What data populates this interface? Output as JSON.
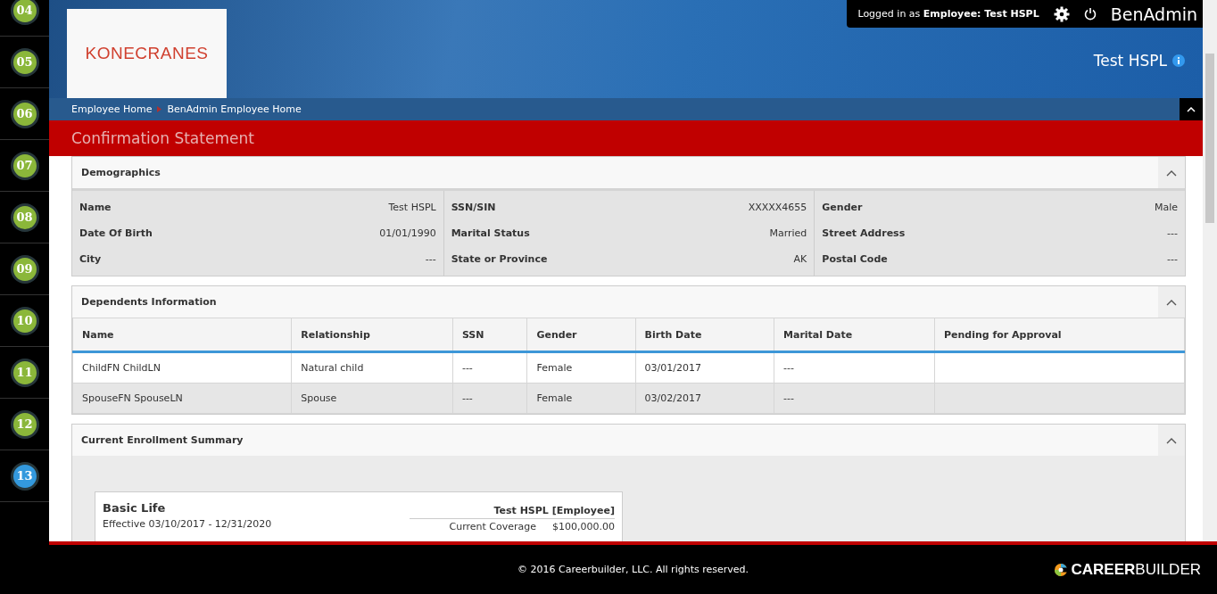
{
  "sidebar": {
    "steps": [
      {
        "label": "04",
        "selected": false
      },
      {
        "label": "05",
        "selected": false
      },
      {
        "label": "06",
        "selected": false
      },
      {
        "label": "07",
        "selected": false
      },
      {
        "label": "08",
        "selected": false
      },
      {
        "label": "09",
        "selected": false
      },
      {
        "label": "10",
        "selected": false
      },
      {
        "label": "11",
        "selected": false
      },
      {
        "label": "12",
        "selected": false
      },
      {
        "label": "13",
        "selected": true
      }
    ]
  },
  "header": {
    "logo": "KONECRANES",
    "session": "Logged in as **Employee:  Test HSPL**",
    "app_name": "BenAdmin",
    "employee_name": "Test HSPL"
  },
  "breadcrumbs": [
    "Employee Home",
    "BenAdmin Employee Home"
  ],
  "page_title": "Confirmation Statement",
  "demographics": {
    "title": "Demographics",
    "columns": [
      [
        {
          "label": "Name",
          "value": "Test HSPL"
        },
        {
          "label": "Date Of Birth",
          "value": "01/01/1990"
        },
        {
          "label": "City",
          "value": "---"
        }
      ],
      [
        {
          "label": "SSN/SIN",
          "value": "XXXXX4655"
        },
        {
          "label": "Marital Status",
          "value": "Married"
        },
        {
          "label": "State or Province",
          "value": "AK"
        }
      ],
      [
        {
          "label": "Gender",
          "value": "Male"
        },
        {
          "label": "Street Address",
          "value": "---"
        },
        {
          "label": "Postal Code",
          "value": "---"
        }
      ]
    ]
  },
  "dependents": {
    "title": "Dependents Information",
    "columns": [
      "Name",
      "Relationship",
      "SSN",
      "Gender",
      "Birth Date",
      "Marital Date",
      "Pending for Approval"
    ],
    "rows": [
      [
        "ChildFN ChildLN",
        "Natural child",
        "---",
        "Female",
        "03/01/2017",
        "---"
      ],
      [
        "SpouseFN SpouseLN",
        "Spouse",
        "---",
        "Female",
        "03/02/2017",
        "---"
      ]
    ]
  },
  "enrollment": {
    "title": "Current Enrollment Summary",
    "plans": [
      {
        "name": "Basic Life",
        "effective": "Effective 03/10/2017 - 12/31/2020",
        "coverage_for": "Test HSPL [Employee]",
        "coverage_label": "Current Coverage",
        "coverage_amount": "$100,000.00"
      }
    ]
  },
  "footer": {
    "copyright": "© 2016 Careerbuilder, LLC. All rights reserved.",
    "brand_bold": "CAREER",
    "brand_light": "BUILDER"
  }
}
